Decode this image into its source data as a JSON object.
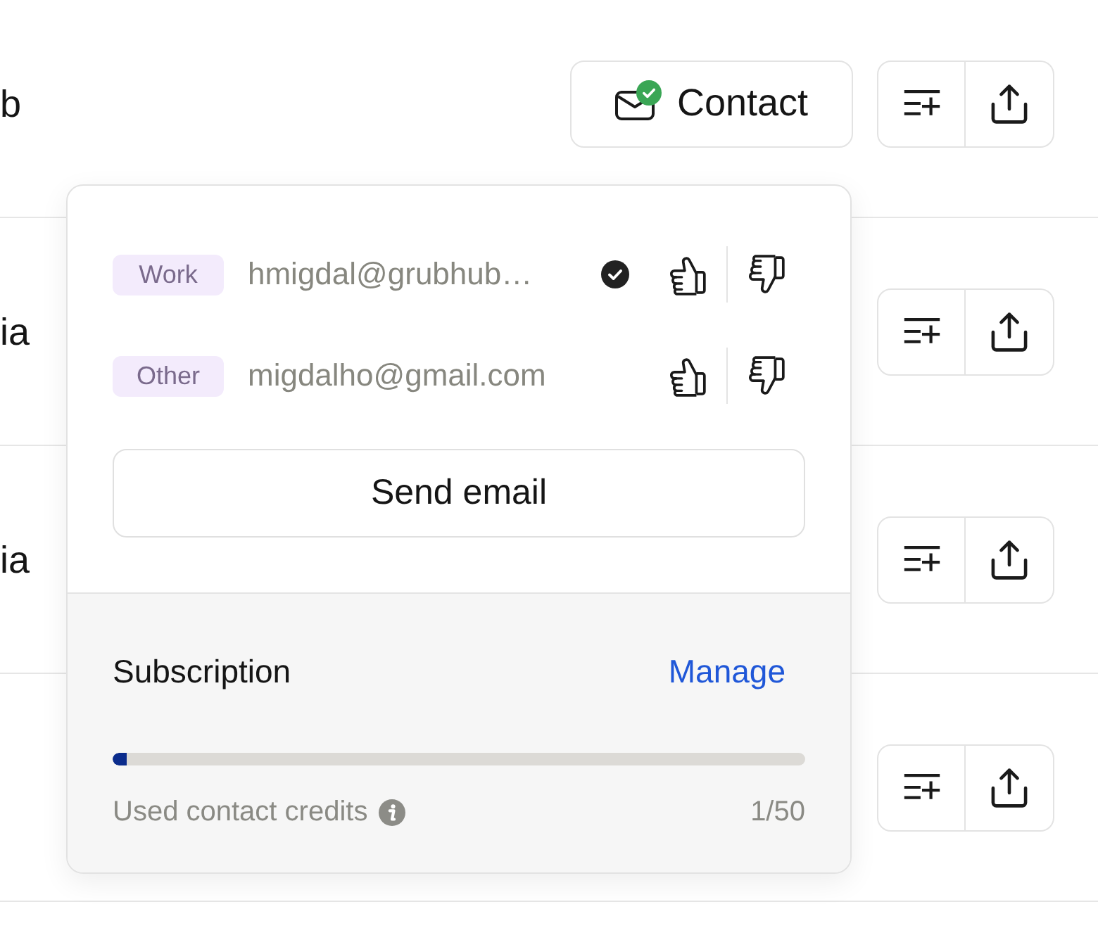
{
  "rows": [
    {
      "name": "b",
      "contact_button": {
        "label": "Contact",
        "verified": true
      }
    },
    {
      "name": "ia"
    },
    {
      "name": "ia"
    },
    {}
  ],
  "popover": {
    "emails": [
      {
        "label": "Work",
        "address": "hmigdal@grubhub…",
        "verified": true
      },
      {
        "label": "Other",
        "address": "migdalho@gmail.com",
        "verified": false
      }
    ],
    "send_button": "Send email",
    "subscription": {
      "title": "Subscription",
      "manage_link": "Manage",
      "level": 0.02,
      "credits_label": "Used contact credits",
      "credits_value": "1/50"
    }
  }
}
